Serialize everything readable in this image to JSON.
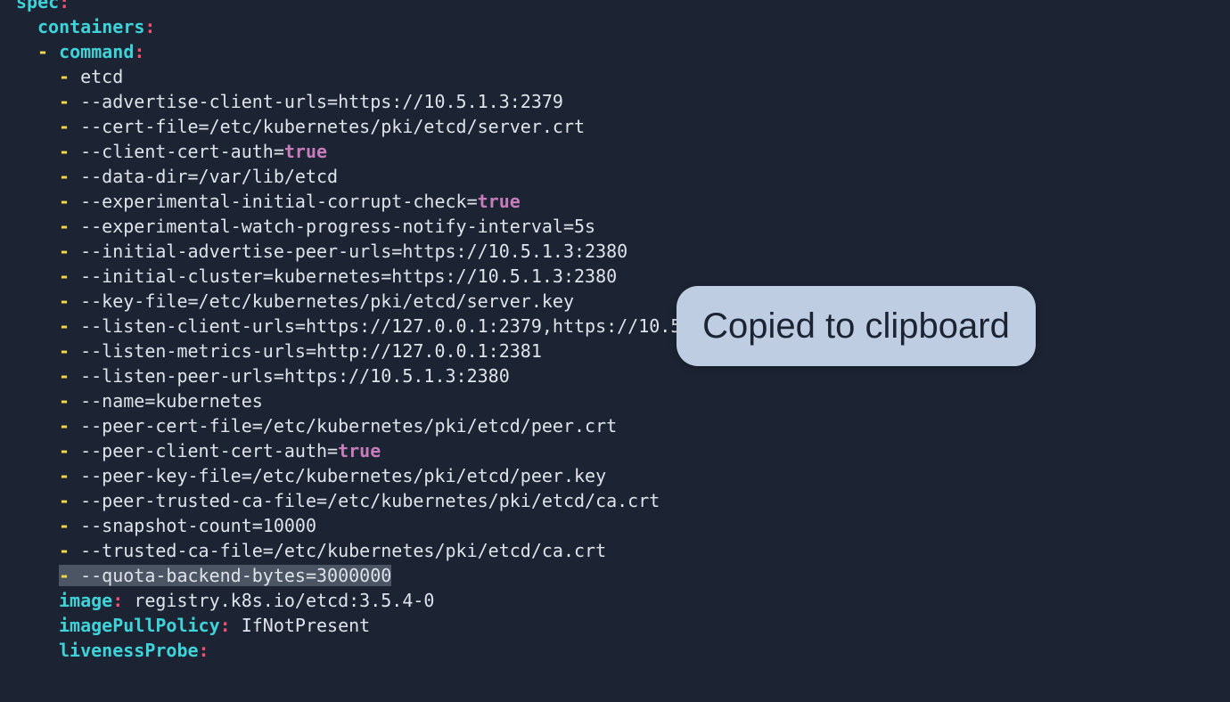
{
  "editor": {
    "lines": [
      {
        "indent": 0,
        "dash": false,
        "key": "spec",
        "value": "",
        "bool": "",
        "selected": false
      },
      {
        "indent": 2,
        "dash": false,
        "key": "containers",
        "value": "",
        "bool": "",
        "selected": false
      },
      {
        "indent": 2,
        "dash": true,
        "key": "command",
        "value": "",
        "bool": "",
        "selected": false
      },
      {
        "indent": 3,
        "dash": true,
        "key": "",
        "value": "etcd",
        "bool": "",
        "selected": false
      },
      {
        "indent": 3,
        "dash": true,
        "key": "",
        "value": "--advertise-client-urls=https://10.5.1.3:2379",
        "bool": "",
        "selected": false
      },
      {
        "indent": 3,
        "dash": true,
        "key": "",
        "value": "--cert-file=/etc/kubernetes/pki/etcd/server.crt",
        "bool": "",
        "selected": false
      },
      {
        "indent": 3,
        "dash": true,
        "key": "",
        "value": "--client-cert-auth=",
        "bool": "true",
        "selected": false
      },
      {
        "indent": 3,
        "dash": true,
        "key": "",
        "value": "--data-dir=/var/lib/etcd",
        "bool": "",
        "selected": false
      },
      {
        "indent": 3,
        "dash": true,
        "key": "",
        "value": "--experimental-initial-corrupt-check=",
        "bool": "true",
        "selected": false
      },
      {
        "indent": 3,
        "dash": true,
        "key": "",
        "value": "--experimental-watch-progress-notify-interval=5s",
        "bool": "",
        "selected": false
      },
      {
        "indent": 3,
        "dash": true,
        "key": "",
        "value": "--initial-advertise-peer-urls=https://10.5.1.3:2380",
        "bool": "",
        "selected": false
      },
      {
        "indent": 3,
        "dash": true,
        "key": "",
        "value": "--initial-cluster=kubernetes=https://10.5.1.3:2380",
        "bool": "",
        "selected": false
      },
      {
        "indent": 3,
        "dash": true,
        "key": "",
        "value": "--key-file=/etc/kubernetes/pki/etcd/server.key",
        "bool": "",
        "selected": false
      },
      {
        "indent": 3,
        "dash": true,
        "key": "",
        "value": "--listen-client-urls=https://127.0.0.1:2379,https://10.5",
        "bool": "",
        "selected": false
      },
      {
        "indent": 3,
        "dash": true,
        "key": "",
        "value": "--listen-metrics-urls=http://127.0.0.1:2381",
        "bool": "",
        "selected": false
      },
      {
        "indent": 3,
        "dash": true,
        "key": "",
        "value": "--listen-peer-urls=https://10.5.1.3:2380",
        "bool": "",
        "selected": false
      },
      {
        "indent": 3,
        "dash": true,
        "key": "",
        "value": "--name=kubernetes",
        "bool": "",
        "selected": false
      },
      {
        "indent": 3,
        "dash": true,
        "key": "",
        "value": "--peer-cert-file=/etc/kubernetes/pki/etcd/peer.crt",
        "bool": "",
        "selected": false
      },
      {
        "indent": 3,
        "dash": true,
        "key": "",
        "value": "--peer-client-cert-auth=",
        "bool": "true",
        "selected": false
      },
      {
        "indent": 3,
        "dash": true,
        "key": "",
        "value": "--peer-key-file=/etc/kubernetes/pki/etcd/peer.key",
        "bool": "",
        "selected": false
      },
      {
        "indent": 3,
        "dash": true,
        "key": "",
        "value": "--peer-trusted-ca-file=/etc/kubernetes/pki/etcd/ca.crt",
        "bool": "",
        "selected": false
      },
      {
        "indent": 3,
        "dash": true,
        "key": "",
        "value": "--snapshot-count=10000",
        "bool": "",
        "selected": false
      },
      {
        "indent": 3,
        "dash": true,
        "key": "",
        "value": "--trusted-ca-file=/etc/kubernetes/pki/etcd/ca.crt",
        "bool": "",
        "selected": false
      },
      {
        "indent": 3,
        "dash": true,
        "key": "",
        "value": "--quota-backend-bytes=3000000",
        "bool": "",
        "selected": true
      },
      {
        "indent": 3,
        "dash": false,
        "key": "image",
        "value": "registry.k8s.io/etcd:3.5.4-0",
        "bool": "",
        "selected": false
      },
      {
        "indent": 3,
        "dash": false,
        "key": "imagePullPolicy",
        "value": "IfNotPresent",
        "bool": "",
        "selected": false
      },
      {
        "indent": 3,
        "dash": false,
        "key": "livenessProbe",
        "value": "",
        "bool": "",
        "selected": false
      }
    ]
  },
  "toast": {
    "message": "Copied to clipboard"
  },
  "colors": {
    "background": "#1c2433",
    "key": "#3ed3d9",
    "colon": "#f0506e",
    "dash": "#f5d742",
    "boolean": "#c77dbb",
    "text": "#dfe3ea",
    "selection": "#4b5563",
    "toast_background": "#bfcde2"
  }
}
